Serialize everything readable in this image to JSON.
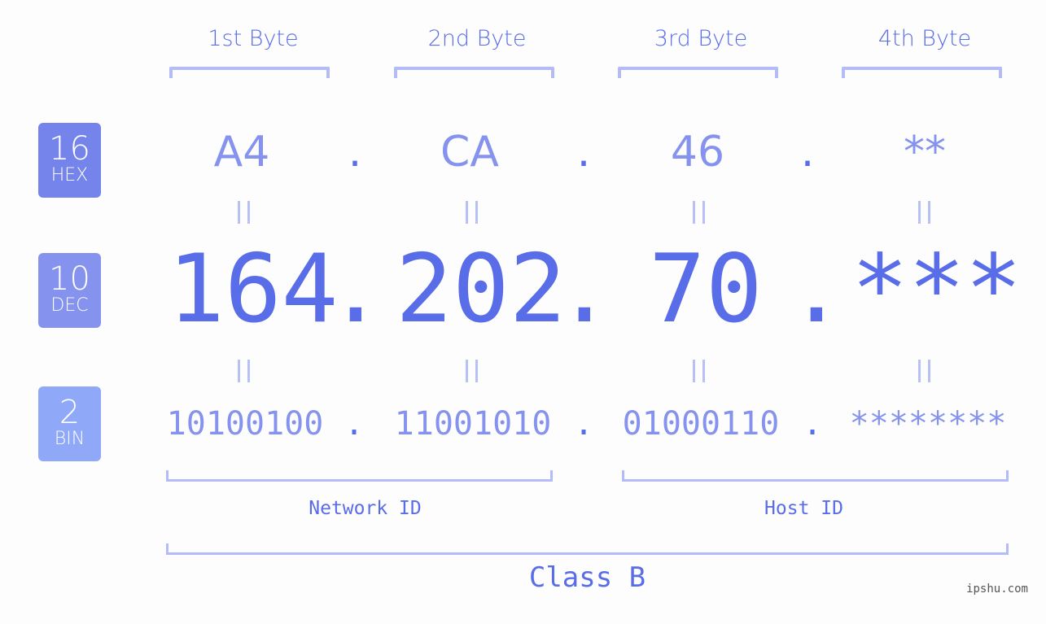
{
  "bytes": [
    {
      "header": "1st Byte",
      "hex": "A4",
      "dec": "164",
      "bin": "10100100"
    },
    {
      "header": "2nd Byte",
      "hex": "CA",
      "dec": "202",
      "bin": "11001010"
    },
    {
      "header": "3rd Byte",
      "hex": "46",
      "dec": "70",
      "bin": "01000110"
    },
    {
      "header": "4th Byte",
      "hex": "**",
      "dec": "***",
      "bin": "********"
    }
  ],
  "separator": ".",
  "badges": {
    "hex": {
      "num": "16",
      "label": "HEX",
      "color": "#7584ea"
    },
    "dec": {
      "num": "10",
      "label": "DEC",
      "color": "#8593ee"
    },
    "bin": {
      "num": "2",
      "label": "BIN",
      "color": "#8fa8f8"
    }
  },
  "groups": {
    "network": "Network ID",
    "host": "Host ID",
    "class": "Class B"
  },
  "watermark": "ipshu.com",
  "colors": {
    "primary": "#5a6de8",
    "light": "#8593ee",
    "bracket": "#b4bcf7"
  }
}
